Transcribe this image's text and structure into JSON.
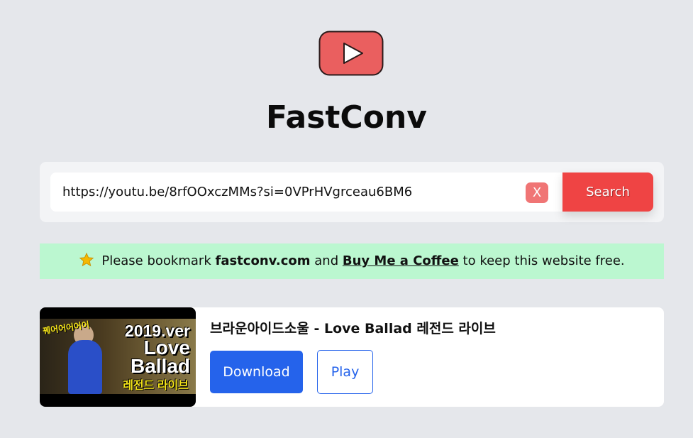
{
  "header": {
    "logo_icon": "youtube-play-icon",
    "title": "FastConv"
  },
  "search": {
    "value": "https://youtu.be/8rfOOxczMMs?si=0VPrHVgrceau6BM6",
    "clear_label": "X",
    "button_label": "Search"
  },
  "notice": {
    "icon": "star-icon",
    "prefix": "Please bookmark",
    "site": "fastconv.com",
    "middle": "and",
    "link_label": "Buy Me a Coffee",
    "suffix": "to keep this website free."
  },
  "result": {
    "title": "브라운아이드소울 - Love Ballad 레전드 라이브",
    "thumbnail": {
      "year_text": "2019.ver",
      "title_line1": "Love",
      "title_line2": "Ballad",
      "subtitle": "레전드 라이브",
      "side_text": "꿰어어어어어"
    },
    "download_label": "Download",
    "play_label": "Play"
  },
  "colors": {
    "background": "#e5e7eb",
    "logo_red": "#ea5f5f",
    "search_button": "#ef4444",
    "clear_button": "#f07575",
    "notice_bg": "#bbf7d0",
    "download_button": "#2563eb"
  }
}
